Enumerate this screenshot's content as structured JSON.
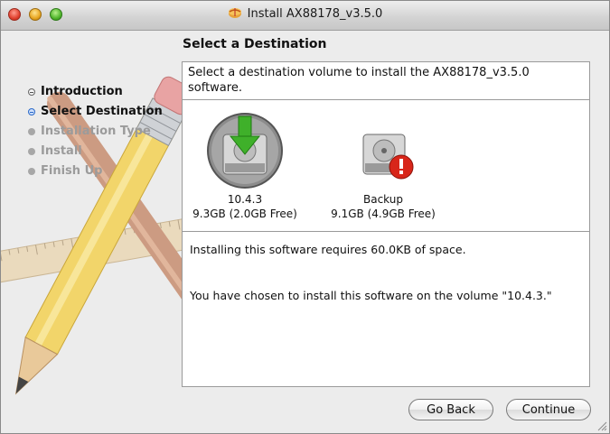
{
  "window": {
    "title": "Install AX88178_v3.5.0",
    "title_icon": "package-icon"
  },
  "sidebar": {
    "steps": [
      {
        "label": "Introduction",
        "state": "done"
      },
      {
        "label": "Select Destination",
        "state": "current"
      },
      {
        "label": "Installation Type",
        "state": "pending"
      },
      {
        "label": "Install",
        "state": "pending"
      },
      {
        "label": "Finish Up",
        "state": "pending"
      }
    ]
  },
  "main": {
    "heading": "Select a Destination",
    "description": "Select a destination volume to install the AX88178_v3.5.0 software.",
    "volumes": [
      {
        "name": "10.4.3",
        "space": "9.3GB (2.0GB Free)",
        "selected": true,
        "icon": "hard-drive-install-arrow-icon"
      },
      {
        "name": "Backup",
        "space": "9.1GB (4.9GB Free)",
        "selected": false,
        "icon": "hard-drive-alert-icon"
      }
    ],
    "space_required": "Installing this software requires 60.0KB of space.",
    "chosen_volume": "You have chosen to install this software on the volume \"10.4.3.\""
  },
  "buttons": {
    "go_back": "Go Back",
    "continue": "Continue"
  },
  "colors": {
    "accent": "#2a68c8",
    "arrow_green": "#3fb02a",
    "alert_red": "#d8261a"
  }
}
